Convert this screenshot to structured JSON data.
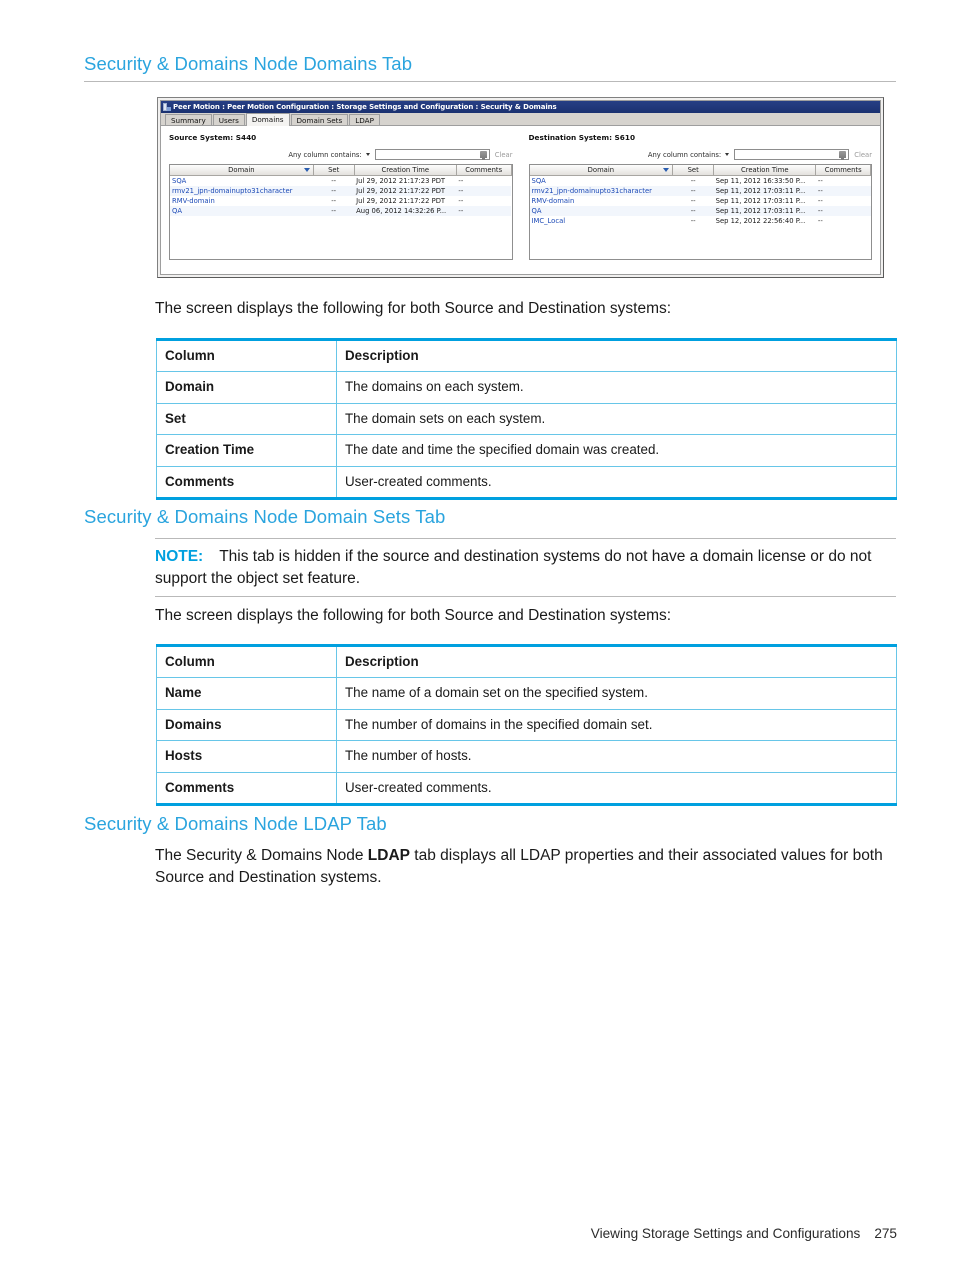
{
  "page": {
    "heading_1": "Security & Domains Node Domains Tab",
    "heading_2": "Security & Domains Node Domain Sets Tab",
    "heading_3": "Security & Domains Node LDAP Tab",
    "intro_1": "The screen displays the following for both Source and Destination systems:",
    "intro_2": "The screen displays the following for both Source and Destination systems:",
    "note_label": "NOTE:",
    "note_text": "This tab is hidden if the source and destination systems do not have a domain license or do not support the object set feature.",
    "ldap_text_before": "The Security & Domains Node ",
    "ldap_text_bold": "LDAP",
    "ldap_text_after": " tab displays all LDAP properties and their associated values for both Source and Destination systems.",
    "footer_text": "Viewing Storage Settings and Configurations",
    "footer_page": "275",
    "accent_color": "#00a0df",
    "heading_color": "#2aa4de"
  },
  "screenshot": {
    "title": "Peer Motion : Peer Motion Configuration : Storage Settings and Configuration : Security & Domains",
    "title_icon": "application-icon",
    "tabs": [
      {
        "label": "Summary",
        "active": false
      },
      {
        "label": "Users",
        "active": false
      },
      {
        "label": "Domains",
        "active": true
      },
      {
        "label": "Domain Sets",
        "active": false
      },
      {
        "label": "LDAP",
        "active": false
      }
    ],
    "source": {
      "system_label": "Source System: S440",
      "filter_label": "Any column contains:",
      "filter_value": "",
      "filter_placeholder": "",
      "filter_icon": "filter-funnel-icon",
      "clear_label": "Clear",
      "columns": [
        "Domain",
        "Set",
        "Creation Time",
        "Comments"
      ],
      "sorted_column": "Domain",
      "rows": [
        {
          "domain": "SQA",
          "set": "--",
          "time": "Jul 29, 2012 21:17:23 PDT",
          "comments": "--"
        },
        {
          "domain": "rmv21_jpn-domainupto31character",
          "set": "--",
          "time": "Jul 29, 2012 21:17:22 PDT",
          "comments": "--"
        },
        {
          "domain": "RMV-domain",
          "set": "--",
          "time": "Jul 29, 2012 21:17:22 PDT",
          "comments": "--"
        },
        {
          "domain": "QA",
          "set": "--",
          "time": "Aug 06, 2012 14:32:26 P...",
          "comments": "--"
        }
      ]
    },
    "destination": {
      "system_label": "Destination System: S610",
      "filter_label": "Any column contains:",
      "filter_value": "",
      "filter_placeholder": "",
      "filter_icon": "filter-funnel-icon",
      "clear_label": "Clear",
      "columns": [
        "Domain",
        "Set",
        "Creation Time",
        "Comments"
      ],
      "sorted_column": "Domain",
      "rows": [
        {
          "domain": "SQA",
          "set": "--",
          "time": "Sep 11, 2012 16:33:50 P...",
          "comments": "--"
        },
        {
          "domain": "rmv21_jpn-domainupto31character",
          "set": "--",
          "time": "Sep 11, 2012 17:03:11 P...",
          "comments": "--"
        },
        {
          "domain": "RMV-domain",
          "set": "--",
          "time": "Sep 11, 2012 17:03:11 P...",
          "comments": "--"
        },
        {
          "domain": "QA",
          "set": "--",
          "time": "Sep 11, 2012 17:03:11 P...",
          "comments": "--"
        },
        {
          "domain": "IMC_Local",
          "set": "--",
          "time": "Sep 12, 2012 22:56:40 P...",
          "comments": "--"
        }
      ]
    }
  },
  "table_domains": {
    "header": {
      "column": "Column",
      "description": "Description"
    },
    "rows": [
      {
        "column": "Domain",
        "description": "The domains on each system."
      },
      {
        "column": "Set",
        "description": "The domain sets on each system."
      },
      {
        "column": "Creation Time",
        "description": "The date and time the specified domain was created."
      },
      {
        "column": "Comments",
        "description": "User-created comments."
      }
    ]
  },
  "table_domain_sets": {
    "header": {
      "column": "Column",
      "description": "Description"
    },
    "rows": [
      {
        "column": "Name",
        "description": "The name of a domain set on the specified system."
      },
      {
        "column": "Domains",
        "description": "The number of domains in the specified domain set."
      },
      {
        "column": "Hosts",
        "description": "The number of hosts."
      },
      {
        "column": "Comments",
        "description": "User-created comments."
      }
    ]
  }
}
